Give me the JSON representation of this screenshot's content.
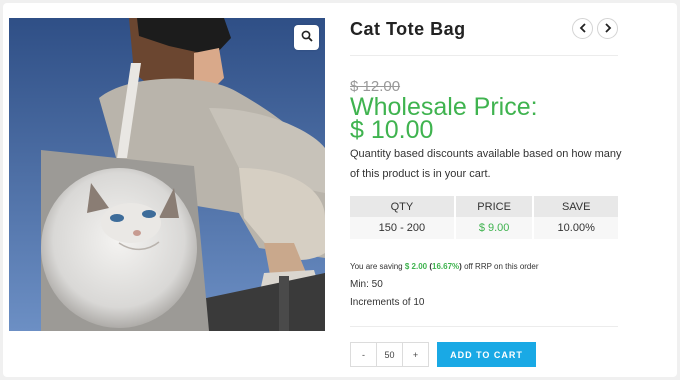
{
  "product": {
    "title": "Cat Tote Bag",
    "old_price": "$ 12.00",
    "wholesale_label": "Wholesale Price:",
    "wholesale_price": "$ 10.00",
    "description": "Quantity based discounts available based on how many of this product is in your cart."
  },
  "tiers": {
    "headers": [
      "QTY",
      "PRICE",
      "SAVE"
    ],
    "rows": [
      {
        "qty": "150 - 200",
        "price": "$ 9.00",
        "save": "10.00%"
      }
    ]
  },
  "saving": {
    "prefix": "You are saving",
    "amount": "$ 2.00",
    "percent": "16.67%",
    "suffix": "off RRP on this order"
  },
  "meta": {
    "min": "Min: 50",
    "increments": "Increments of 10"
  },
  "cart": {
    "minus": "-",
    "quantity": "50",
    "plus": "+",
    "add_label": "ADD TO CART"
  },
  "icons": {
    "zoom": "magnifier-icon",
    "prev": "chevron-left-icon",
    "next": "chevron-right-icon"
  },
  "colors": {
    "accent_green": "#3fb34f",
    "button_blue": "#19a9e5"
  }
}
